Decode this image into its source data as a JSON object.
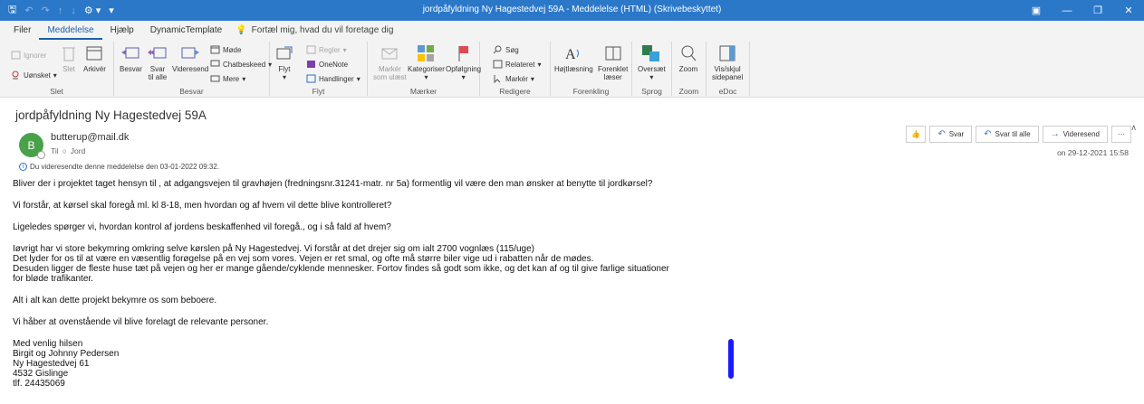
{
  "titlebar": {
    "title": "jordpåfyldning Ny Hagestedvej 59A  -  Meddelelse (HTML) (Skrivebeskyttet)"
  },
  "menu": {
    "tabs": [
      "Filer",
      "Meddelelse",
      "Hjælp",
      "DynamicTemplate"
    ],
    "tell_me": "Fortæl mig, hvad du vil foretage dig"
  },
  "ribbon": {
    "slet": {
      "ignorer": "Ignorer",
      "uonsket": "Uønsket",
      "slet": "Slet",
      "arkiver": "Arkivér",
      "label": "Slet"
    },
    "besvar": {
      "besvar": "Besvar",
      "svar_til_alle_1": "Svar",
      "svar_til_alle_2": "til alle",
      "videresend": "Videresend",
      "mode": "Møde",
      "chatbeskeed": "Chatbeskeed",
      "mere": "Mere",
      "label": "Besvar"
    },
    "flyt": {
      "flyt": "Flyt",
      "regler": "Regler",
      "onenote": "OneNote",
      "handlinger": "Handlinger",
      "label": "Flyt"
    },
    "maerker": {
      "marker_som_ulaest_1": "Markér",
      "marker_som_ulaest_2": "som ulæst",
      "kategoriser": "Kategoriser",
      "opfolgning": "Opfølgning",
      "label": "Mærker"
    },
    "rediger": {
      "sog": "Søg",
      "relateret": "Relateret",
      "marker": "Markér",
      "label": "Redigere"
    },
    "forenkling": {
      "hojtlaesning": "Højtlæsning",
      "forenklet_1": "Forenklet",
      "forenklet_2": "læser",
      "label": "Forenkling"
    },
    "sprog": {
      "oversaet": "Oversæt",
      "label": "Sprog"
    },
    "zoom": {
      "zoom": "Zoom",
      "label": "Zoom"
    },
    "edoc": {
      "vis_skjul_1": "Vis/skjul",
      "vis_skjul_2": "sidepanel",
      "label": "eDoc"
    }
  },
  "message": {
    "subject": "jordpåfyldning Ny Hagestedvej 59A",
    "avatar_initial": "B",
    "sender": "butterup@mail.dk",
    "to_label": "Til",
    "to_value": "Jord",
    "forward_note": "Du videresendte denne meddelelse den 03-01-2022 09:32.",
    "date": "on 29-12-2021 15:58",
    "actions": {
      "svar": "Svar",
      "svar_til_alle": "Svar til alle",
      "videresend": "Videresend",
      "more": "···"
    },
    "body": {
      "p1": "Bliver der i projektet taget hensyn til , at adgangsvejen til gravhøjen (fredningsnr.31241-matr. nr 5a) formentlig vil være den man ønsker at benytte til jordkørsel?",
      "p2": "Vi forstår, at kørsel skal foregå ml. kl 8-18, men hvordan og af hvem vil dette blive kontrolleret?",
      "p3": "Ligeledes spørger vi, hvordan kontrol af jordens beskaffenhed vil foregå., og i så fald af hvem?",
      "p4_l1": "Iøvrigt har vi store bekymring omkring selve kørslen på Ny Hagestedvej. Vi forstår at det drejer sig om ialt 2700 vognlæs (115/uge)",
      "p4_l2": "Det lyder for os til at være en væsentlig forøgelse på en vej som vores. Vejen er ret smal, og ofte må større biler vige ud  i rabatten når de mødes.",
      "p4_l3": "Desuden ligger de fleste huse tæt på vejen og her er mange gående/cyklende mennesker. Fortov findes så godt som ikke, og det kan af og til give farlige situationer",
      "p4_l4": "for bløde trafikanter.",
      "p5": "Alt i alt kan dette projekt bekymre os som beboere.",
      "p6": "Vi håber at ovenstående vil blive forelagt de relevante personer.",
      "sig_l1": "Med venlig hilsen",
      "sig_l2": "Birgit og Johnny Pedersen",
      "sig_l3": "Ny Hagestedvej 61",
      "sig_l4": "4532 Gislinge",
      "sig_l5": "tlf. 24435069"
    }
  },
  "colors": {
    "titlebar": "#2b78c9",
    "accent": "#1f5fa8",
    "avatar": "#49a24a",
    "marker": "#1a1aff"
  }
}
